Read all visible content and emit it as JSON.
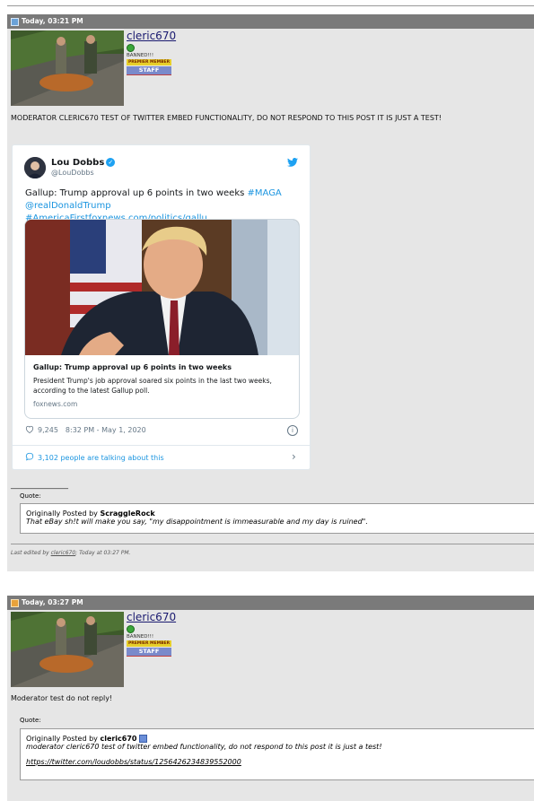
{
  "post1": {
    "header": "Today, 03:21 PM",
    "username": "cleric670",
    "banned": "BANNED!!!",
    "premier": "PREMIER MEMBER",
    "staff": "STAFF",
    "message": "MODERATOR CLERIC670 TEST OF TWITTER EMBED FUNCTIONALITY, DO NOT RESPOND TO THIS POST IT IS JUST A TEST!",
    "tweet": {
      "name": "Lou Dobbs",
      "handle": "@LouDobbs",
      "text_plain": "Gallup: Trump approval up 6 points in two weeks ",
      "hashtag1": "#MAGA",
      "text_line2": "@realDonaldTrump #AmericaFirstfoxnews.com/politics/gallu…",
      "card_title": "Gallup: Trump approval up 6 points in two weeks",
      "card_desc": "President Trump's job approval soared six points in the last two weeks, according to the latest Gallup poll.",
      "card_domain": "foxnews.com",
      "likes": "9,245",
      "time": "8:32 PM - May 1, 2020",
      "talking": "3,102 people are talking about this"
    },
    "signature_line": "________________",
    "quote_label": "Quote:",
    "quote_prefix": "Originally Posted by ",
    "quote_author": "ScraggleRock",
    "quote_text": "That eBay sh!t will make you say, \"my disappointment is immeasurable and my day is ruined\".",
    "edited_prefix": "Last edited by ",
    "edited_user": "cleric670",
    "edited_suffix": "; Today at 03:27 PM."
  },
  "post2": {
    "header": "Today, 03:27 PM",
    "username": "cleric670",
    "banned": "BANNED!!!",
    "premier": "PREMIER MEMBER",
    "staff": "STAFF",
    "message": "Moderator test do not reply!",
    "quote_label": "Quote:",
    "quote_prefix": "Originally Posted by ",
    "quote_author": "cleric670",
    "quote_text": "moderator cleric670 test of twitter embed functionality, do not respond to this post it is just a test!",
    "quote_link": "https://twitter.com/loudobbs/status/1256426234839552000"
  },
  "colors": {
    "header_bg": "#7a7a7a",
    "post_bg": "#e6e6e6",
    "twitter_blue": "#1da1f2",
    "link": "#1b95e0"
  },
  "icons": [
    "post-icon",
    "online-status-icon",
    "verified-icon",
    "twitter-bird-icon",
    "heart-icon",
    "info-icon",
    "comment-icon",
    "chevron-right-icon",
    "view-post-icon"
  ]
}
